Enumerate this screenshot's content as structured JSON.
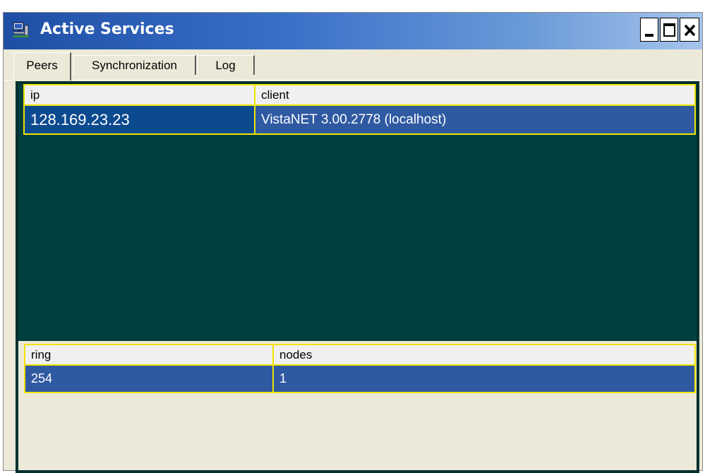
{
  "window": {
    "title": "Active Services",
    "app_icon": "network-computer-icon",
    "controls": {
      "minimize": "minimize-icon",
      "maximize": "maximize-icon",
      "close": "close-icon"
    }
  },
  "tabs": [
    {
      "label": "Peers",
      "active": true
    },
    {
      "label": "Synchronization",
      "active": false
    },
    {
      "label": "Log",
      "active": false
    }
  ],
  "peers_table": {
    "columns": [
      "ip",
      "client"
    ],
    "rows": [
      [
        "128.169.23.23",
        "VistaNET 3.00.2778 (localhost)"
      ]
    ]
  },
  "rings_table": {
    "columns": [
      "ring",
      "nodes"
    ],
    "rows": [
      [
        "254",
        "1"
      ]
    ]
  },
  "colors": {
    "title_bar_start": "#1e4fa5",
    "panel_bg": "#003f3d",
    "grid_border": "#f0e400",
    "selected_row": "#2f5aa2"
  }
}
